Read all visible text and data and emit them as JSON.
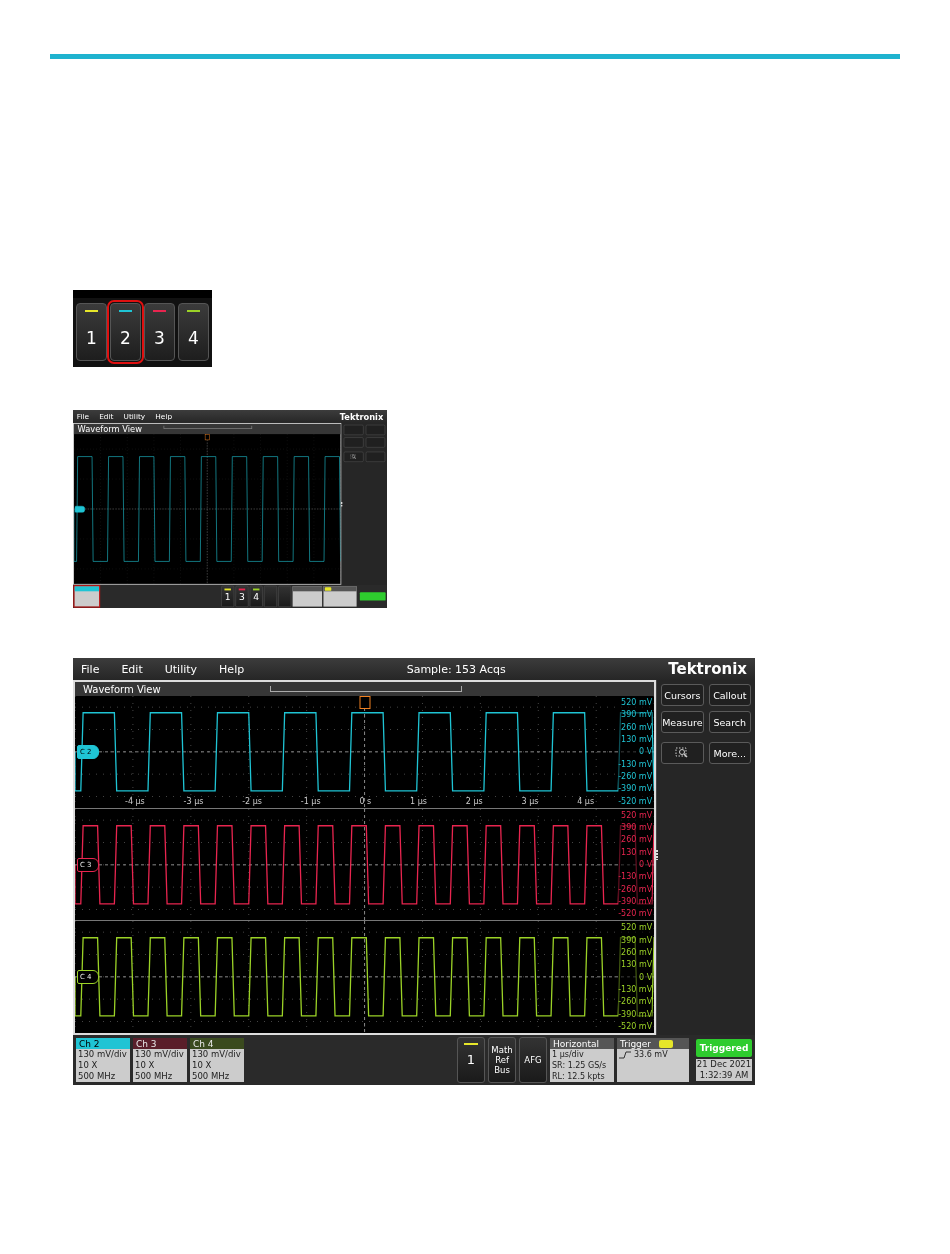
{
  "channel_keys": [
    {
      "label": "1",
      "color": "#e6e62a",
      "selected": false
    },
    {
      "label": "2",
      "color": "#1fc4d4",
      "selected": true
    },
    {
      "label": "3",
      "color": "#e8254f",
      "selected": false
    },
    {
      "label": "4",
      "color": "#9bd227",
      "selected": false
    }
  ],
  "scopes": [
    {
      "menu": [
        "File",
        "Edit",
        "Utility",
        "Help"
      ],
      "brand": "Tektronix",
      "view_title": "Waveform View",
      "channels": [
        {
          "color": "#1fc4d4",
          "kind": "slow",
          "selected": true
        }
      ],
      "side_buttons": [
        {
          "kind": "blank"
        },
        {
          "kind": "blank"
        },
        {
          "kind": "blank"
        },
        {
          "kind": "blank"
        },
        {
          "kind": "icon"
        },
        {
          "kind": "blank"
        }
      ],
      "lamp": {
        "color": "#2ecc2e"
      },
      "badges": [
        {
          "color": "#1fc4d4",
          "highlighted": true
        }
      ],
      "tray_buttons": [
        {
          "kind": "number",
          "label": "1",
          "color": "#e6e62a"
        },
        {
          "kind": "number",
          "label": "3",
          "color": "#e8254f"
        },
        {
          "kind": "number",
          "label": "4",
          "color": "#9bd227"
        },
        {
          "kind": "blank"
        },
        {
          "kind": "blank"
        }
      ]
    },
    {
      "menu": [
        "File",
        "Edit",
        "Utility",
        "Help"
      ],
      "sample": "Sample: 153 Acqs",
      "brand": "Tektronix",
      "view_title": "Waveform View",
      "channels": [
        {
          "label": "C 2",
          "color": "#1fc4d4",
          "kind": "slow",
          "selected": true,
          "y_labels": [
            "520 mV",
            "390 mV",
            "260 mV",
            "130 mV",
            "0 V",
            "-130 mV",
            "-260 mV",
            "-390 mV",
            "-520 mV"
          ],
          "x_ticks": [
            "-4 µs",
            "-3 µs",
            "-2 µs",
            "-1 µs",
            "0 s",
            "1 µs",
            "2 µs",
            "3 µs",
            "4 µs"
          ]
        },
        {
          "label": "C 3",
          "color": "#e8254f",
          "kind": "fast",
          "selected": false,
          "y_labels": [
            "520 mV",
            "390 mV",
            "260 mV",
            "130 mV",
            "0 V",
            "-130 mV",
            "-260 mV",
            "-390 mV",
            "-520 mV"
          ]
        },
        {
          "label": "C 4",
          "color": "#9bd227",
          "kind": "fast",
          "selected": false,
          "y_labels": [
            "520 mV",
            "390 mV",
            "260 mV",
            "130 mV",
            "0 V",
            "-130 mV",
            "-260 mV",
            "-390 mV",
            "-520 mV"
          ]
        }
      ],
      "side_buttons": [
        {
          "kind": "text",
          "label": "Cursors"
        },
        {
          "kind": "text",
          "label": "Callout"
        },
        {
          "kind": "text",
          "label": "Measure"
        },
        {
          "kind": "text",
          "label": "Search"
        },
        {
          "kind": "icon"
        },
        {
          "kind": "text",
          "label": "More..."
        }
      ],
      "badges": [
        {
          "title": "Ch 2",
          "color": "#1fc4d4",
          "selected": true,
          "highlighted": false,
          "lines": [
            "130 mV/div",
            "10 X",
            "500 MHz"
          ]
        },
        {
          "title": "Ch 3",
          "color": "#5a1e2a",
          "selected": false,
          "highlighted": false,
          "lines": [
            "130 mV/div",
            "10 X",
            "500 MHz"
          ]
        },
        {
          "title": "Ch 4",
          "color": "#3a4a1e",
          "selected": false,
          "highlighted": false,
          "lines": [
            "130 mV/div",
            "10 X",
            "500 MHz"
          ]
        }
      ],
      "tray_buttons": [
        {
          "kind": "number",
          "label": "1",
          "color": "#e6e62a"
        },
        {
          "kind": "text",
          "label": "Math Ref Bus"
        },
        {
          "kind": "text",
          "label": "AFG"
        }
      ],
      "horizontal": {
        "title": "Horizontal",
        "lines": [
          "1 µs/div",
          "SR: 1.25 GS/s",
          "RL: 12.5 kpts"
        ]
      },
      "trigger": {
        "title": "Trigger",
        "lines": [
          "33.6 mV"
        ]
      },
      "status": "Triggered",
      "datetime": [
        "21 Dec 2021",
        "1:32:39 AM"
      ]
    }
  ]
}
